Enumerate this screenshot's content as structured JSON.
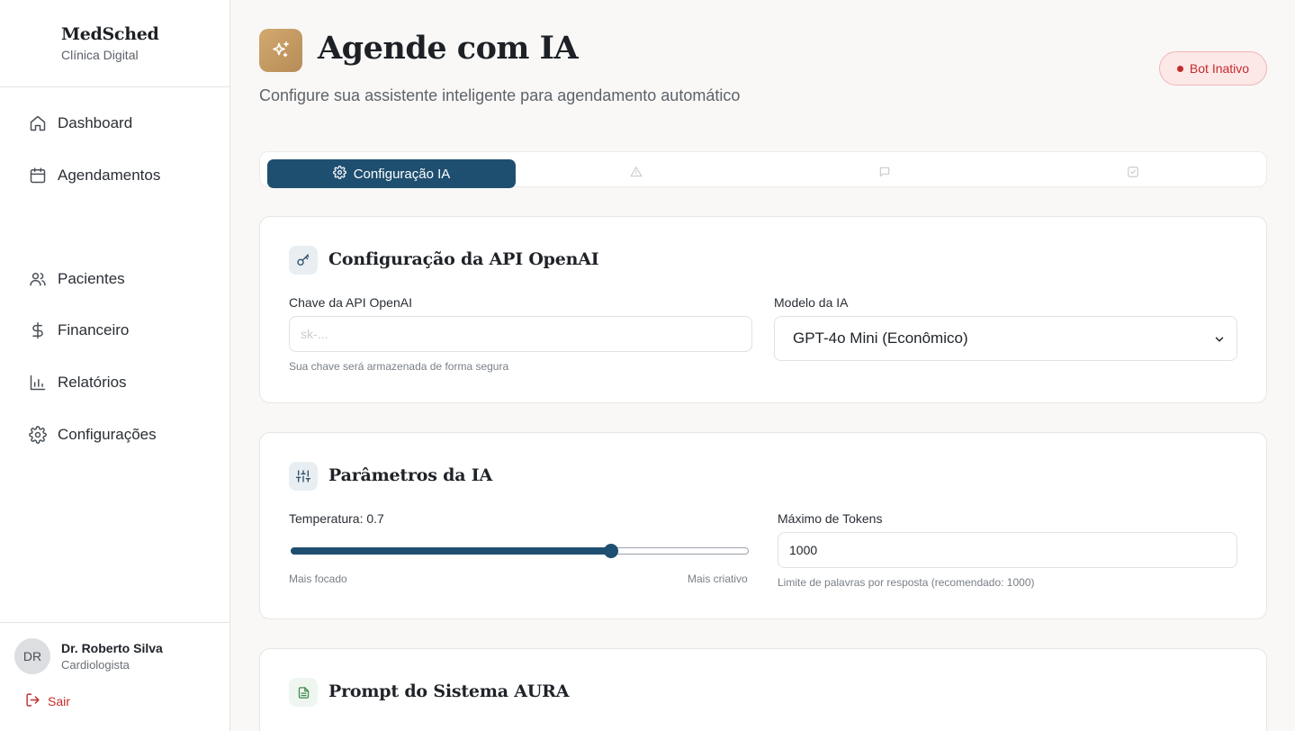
{
  "brand": {
    "name": "MedSched",
    "subtitle": "Clínica Digital"
  },
  "nav": [
    {
      "label": "Dashboard",
      "icon": "home-icon"
    },
    {
      "label": "Agendamentos",
      "icon": "calendar-icon"
    },
    {
      "label": "Pacientes",
      "icon": "users-icon"
    },
    {
      "label": "Financeiro",
      "icon": "dollar-icon"
    },
    {
      "label": "Relatórios",
      "icon": "bar-chart-icon"
    },
    {
      "label": "Configurações",
      "icon": "gear-icon"
    }
  ],
  "user": {
    "initials": "DR",
    "name": "Dr. Roberto Silva",
    "role": "Cardiologista",
    "logout": "Sair"
  },
  "header": {
    "title": "Agende com IA",
    "subtitle": "Configure sua assistente inteligente para agendamento automático",
    "status": "Bot Inativo"
  },
  "tabs": [
    {
      "label": "Configuração IA",
      "active": true,
      "icon": "gear-icon"
    },
    {
      "label": "",
      "active": false,
      "icon": "alert-icon"
    },
    {
      "label": "",
      "active": false,
      "icon": "chat-icon"
    },
    {
      "label": "",
      "active": false,
      "icon": "check-icon"
    }
  ],
  "api_card": {
    "title": "Configuração da API OpenAI",
    "key_label": "Chave da API OpenAI",
    "key_placeholder": "sk-...",
    "key_value": "",
    "key_hint": "Sua chave será armazenada de forma segura",
    "model_label": "Modelo da IA",
    "model_value": "GPT-4o Mini (Econômico)"
  },
  "params_card": {
    "title": "Parâmetros da IA",
    "temperature_label": "Temperatura: 0.7",
    "temperature": 0.7,
    "temperature_min_label": "Mais focado",
    "temperature_max_label": "Mais criativo",
    "tokens_label": "Máximo de Tokens",
    "tokens_value": "1000",
    "tokens_hint": "Limite de palavras por resposta (recomendado: 1000)"
  },
  "prompt_card": {
    "title": "Prompt do Sistema AURA"
  },
  "colors": {
    "primary": "#1f4f70",
    "accent_gold": "#c49a63",
    "danger": "#c42a2a"
  }
}
